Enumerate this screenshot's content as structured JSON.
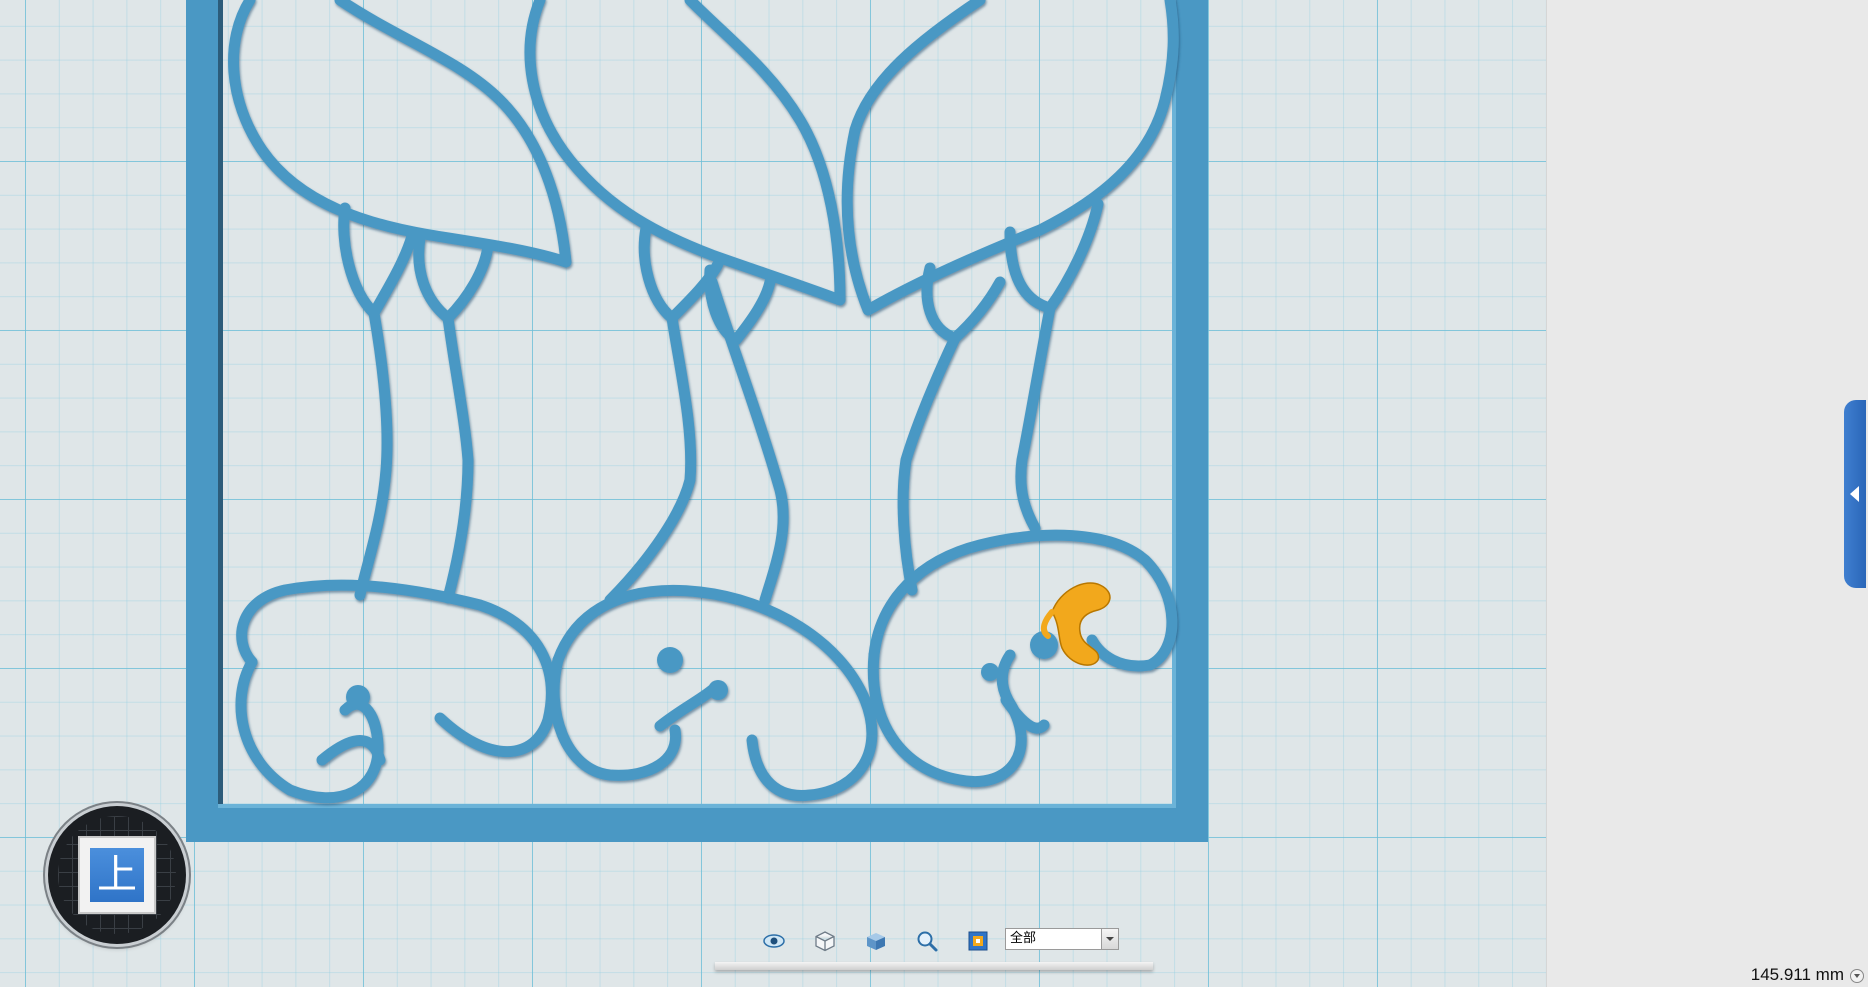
{
  "viewport": {
    "model_color": "#4a98c4",
    "highlight_color": "#f2a81c",
    "grid_color": "#6ebed7"
  },
  "view_cube": {
    "face_label": "上"
  },
  "toolbar": {
    "icons": [
      "eye-icon",
      "wireframe-cube-icon",
      "solid-cube-icon",
      "zoom-icon",
      "render-mode-icon"
    ],
    "filter_value": "全部"
  },
  "status": {
    "measurement": "145.911 mm"
  },
  "right_panel": {
    "toggle_icon": "collapse-arrow-icon",
    "accent_color": "#3f7fd0"
  }
}
